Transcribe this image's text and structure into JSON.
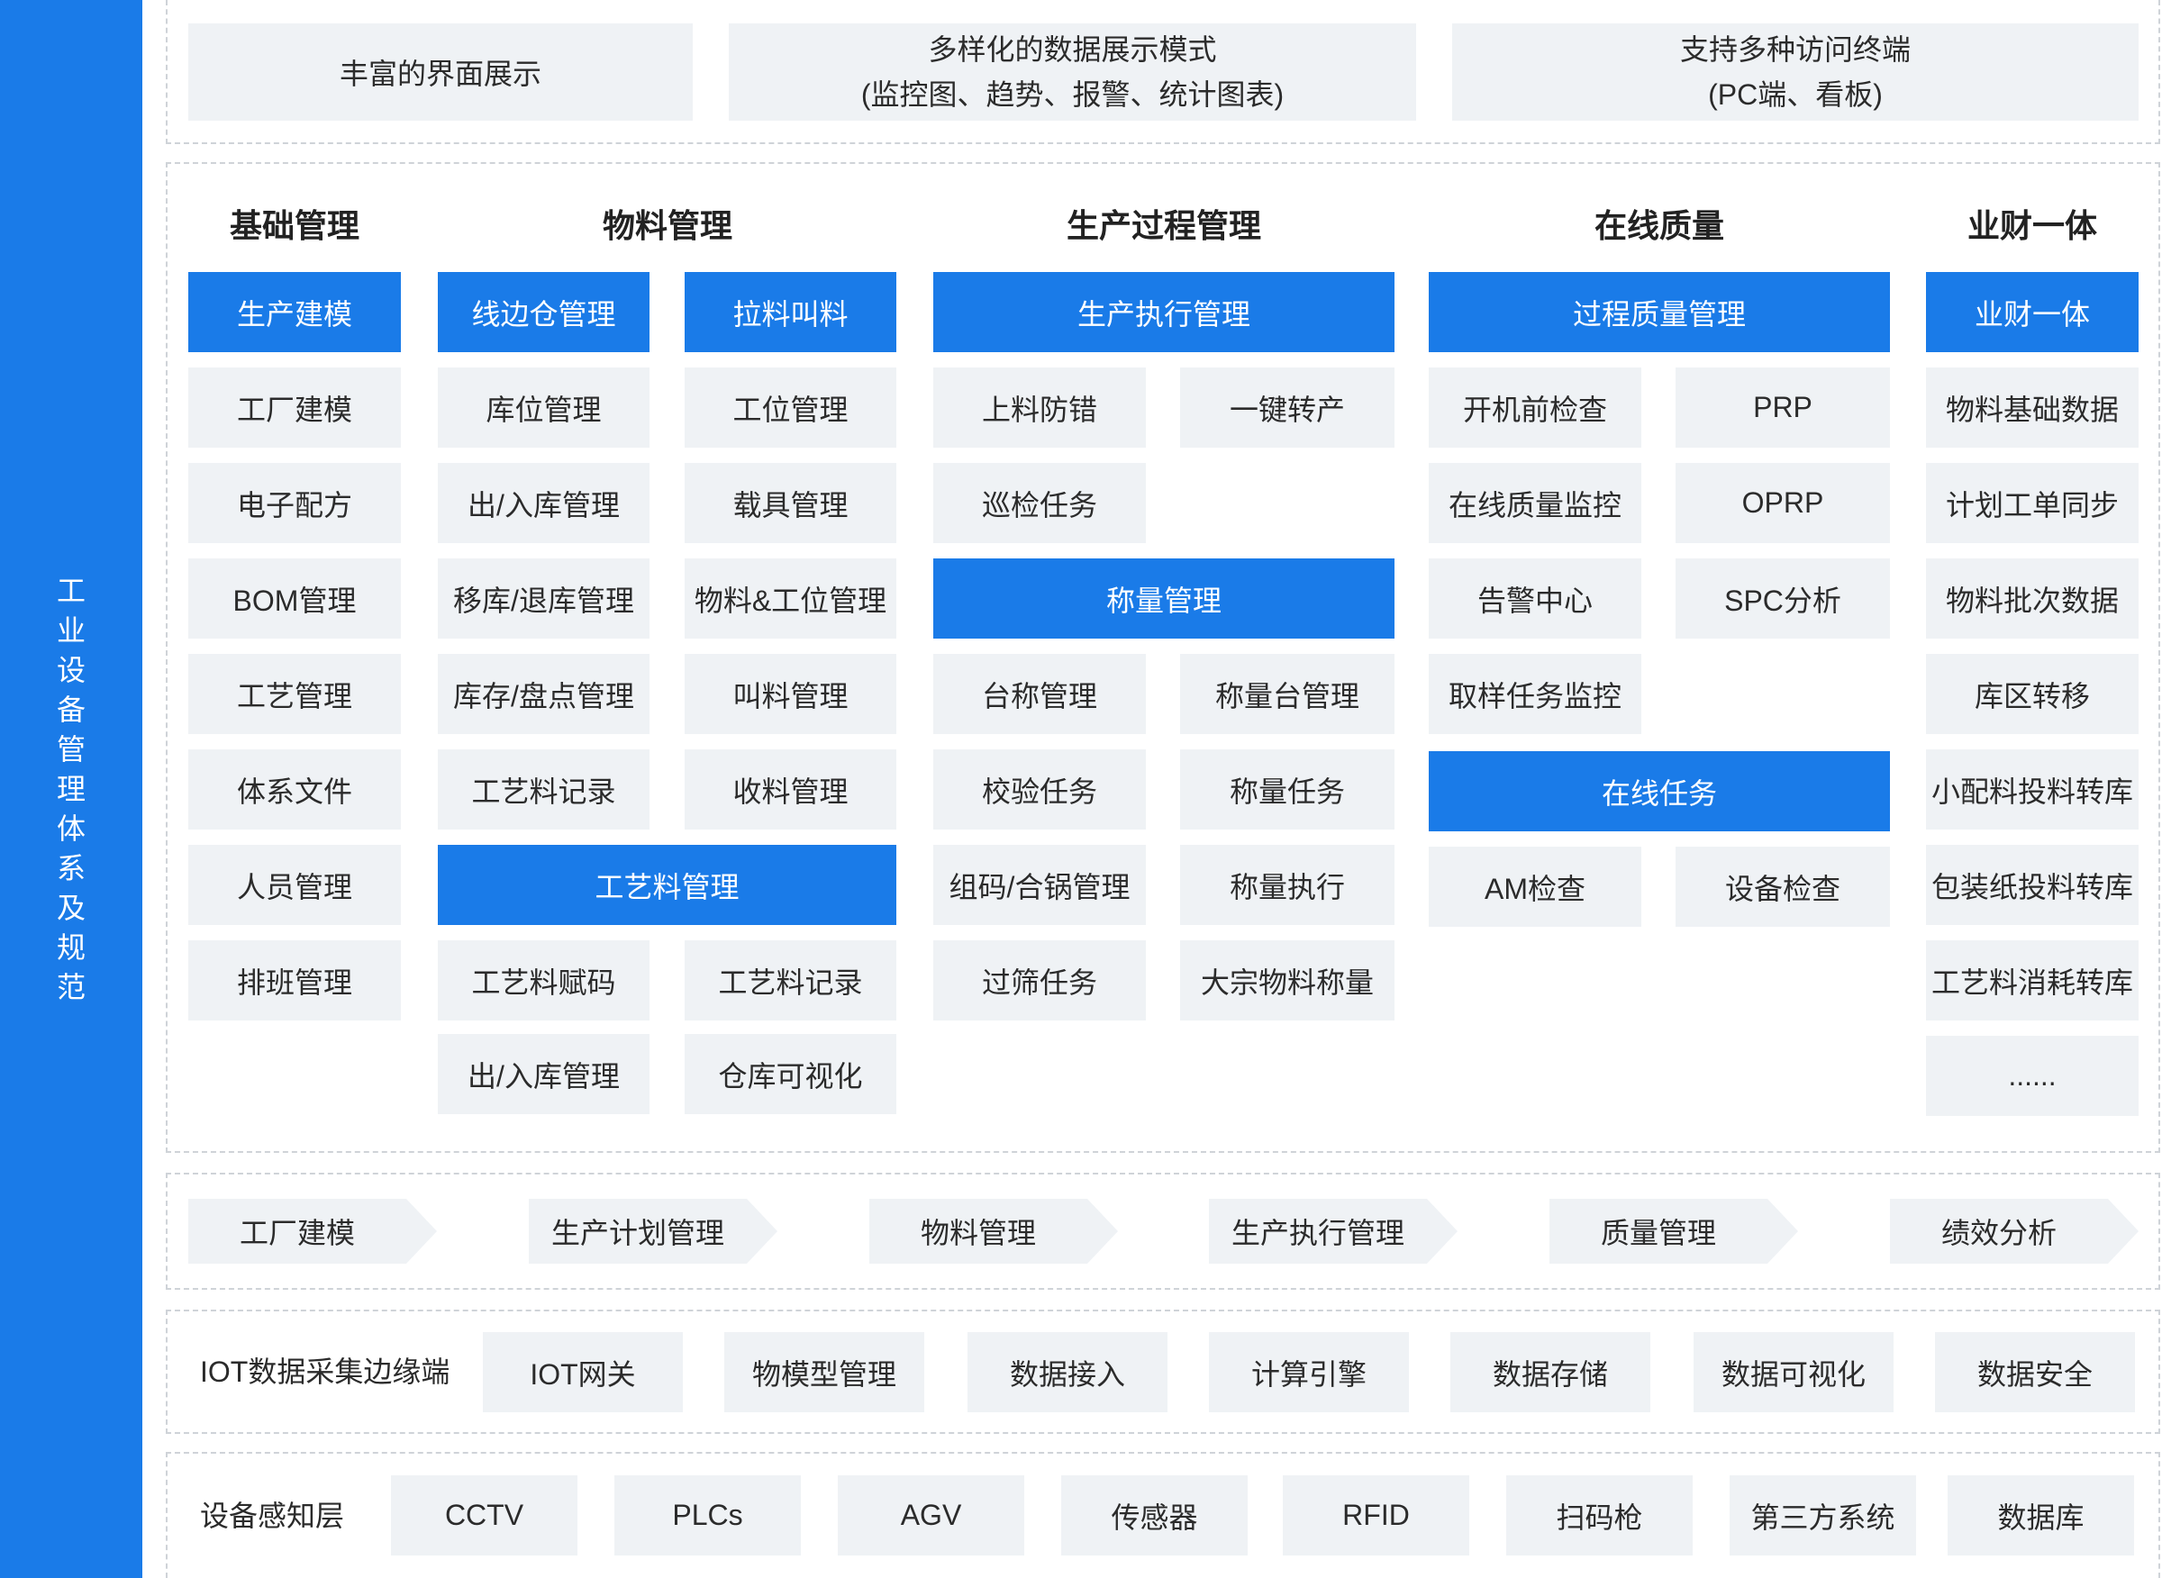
{
  "sidebar": {
    "label": "工业设备管理体系及规范"
  },
  "top": {
    "items": [
      {
        "line1": "丰富的界面展示",
        "line2": ""
      },
      {
        "line1": "多样化的数据展示模式",
        "line2": "(监控图、趋势、报警、统计图表)"
      },
      {
        "line1": "支持多种访问终端",
        "line2": "(PC端、看板)"
      }
    ]
  },
  "modules": {
    "jichu": {
      "heading": "基础管理",
      "blue1": "生产建模",
      "items": [
        "工厂建模",
        "电子配方",
        "BOM管理",
        "工艺管理",
        "体系文件",
        "人员管理",
        "排班管理"
      ]
    },
    "wuliao": {
      "heading": "物料管理",
      "blue1": "线边仓管理",
      "blue2": "拉料叫料",
      "left": [
        "库位管理",
        "出/入库管理",
        "移库/退库管理",
        "库存/盘点管理",
        "工艺料记录"
      ],
      "right": [
        "工位管理",
        "载具管理",
        "物料&工位管理",
        "叫料管理",
        "收料管理"
      ],
      "blue3": "工艺料管理",
      "left2": [
        "工艺料赋码",
        "出/入库管理"
      ],
      "right2": [
        "工艺料记录",
        "仓库可视化"
      ]
    },
    "shengchan": {
      "heading": "生产过程管理",
      "blue1": "生产执行管理",
      "items1": [
        "上料防错",
        "一键转产",
        "巡检任务"
      ],
      "blue2": "称量管理",
      "left": [
        "台称管理",
        "校验任务",
        "组码/合锅管理",
        "过筛任务"
      ],
      "right": [
        "称量台管理",
        "称量任务",
        "称量执行",
        "大宗物料称量"
      ]
    },
    "zhiliang": {
      "heading": "在线质量",
      "blue1": "过程质量管理",
      "left": [
        "开机前检查",
        "在线质量监控",
        "告警中心",
        "取样任务监控"
      ],
      "right": [
        "PRP",
        "OPRP",
        "SPC分析"
      ],
      "blue2": "在线任务",
      "items2": [
        "AM检查",
        "设备检查"
      ]
    },
    "yecai": {
      "heading": "业财一体",
      "blue1": "业财一体",
      "items": [
        "物料基础数据",
        "计划工单同步",
        "物料批次数据",
        "库区转移",
        "小配料投料转库",
        "包装纸投料转库",
        "工艺料消耗转库",
        "......"
      ]
    }
  },
  "flow": {
    "items": [
      "工厂建模",
      "生产计划管理",
      "物料管理",
      "生产执行管理",
      "质量管理",
      "绩效分析"
    ]
  },
  "iot": {
    "label": "IOT数据采集边缘端",
    "items": [
      "IOT网关",
      "物模型管理",
      "数据接入",
      "计算引擎",
      "数据存储",
      "数据可视化",
      "数据安全"
    ]
  },
  "device": {
    "label": "设备感知层",
    "items": [
      "CCTV",
      "PLCs",
      "AGV",
      "传感器",
      "RFID",
      "扫码枪",
      "第三方系统",
      "数据库"
    ]
  },
  "colors": {
    "accent": "#1a7be8",
    "box": "#eff2f5",
    "border": "#cfd3d8"
  }
}
